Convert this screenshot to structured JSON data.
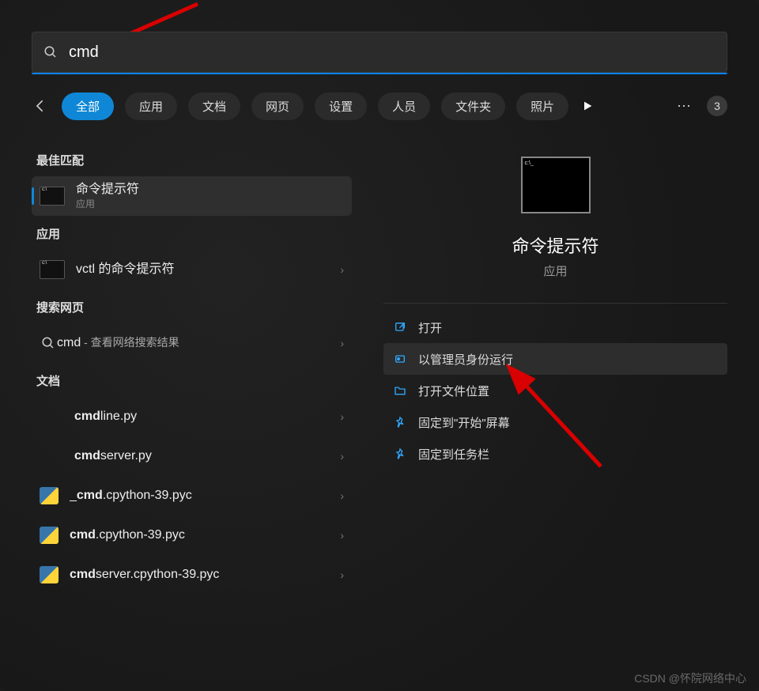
{
  "search": {
    "value": "cmd"
  },
  "filters": {
    "tabs": [
      "全部",
      "应用",
      "文档",
      "网页",
      "设置",
      "人员",
      "文件夹",
      "照片"
    ],
    "badge": "3"
  },
  "sections": {
    "best_match": "最佳匹配",
    "apps": "应用",
    "web": "搜索网页",
    "docs": "文档"
  },
  "results": {
    "best": {
      "title": "命令提示符",
      "sub": "应用"
    },
    "apps": [
      {
        "title": "vctl 的命令提示符"
      }
    ],
    "web": {
      "term": "cmd",
      "suffix": " - 查看网络搜索结果"
    },
    "docs": [
      {
        "pre": "",
        "bold": "cmd",
        "post": "line.py",
        "icon": "empty"
      },
      {
        "pre": "",
        "bold": "cmd",
        "post": "server.py",
        "icon": "empty"
      },
      {
        "pre": "_",
        "bold": "cmd",
        "post": ".cpython-39.pyc",
        "icon": "py"
      },
      {
        "pre": "",
        "bold": "cmd",
        "post": ".cpython-39.pyc",
        "icon": "py"
      },
      {
        "pre": "",
        "bold": "cmd",
        "post": "server.cpython-39.pyc",
        "icon": "py"
      }
    ]
  },
  "preview": {
    "title": "命令提示符",
    "sub": "应用",
    "actions": [
      {
        "name": "open",
        "label": "打开",
        "icon": "open-icon"
      },
      {
        "name": "run-admin",
        "label": "以管理员身份运行",
        "icon": "shield-icon",
        "hover": true
      },
      {
        "name": "open-location",
        "label": "打开文件位置",
        "icon": "folder-icon"
      },
      {
        "name": "pin-start",
        "label": "固定到\"开始\"屏幕",
        "icon": "pin-icon"
      },
      {
        "name": "pin-taskbar",
        "label": "固定到任务栏",
        "icon": "pin-icon"
      }
    ]
  },
  "watermark": "CSDN @怀院网络中心"
}
